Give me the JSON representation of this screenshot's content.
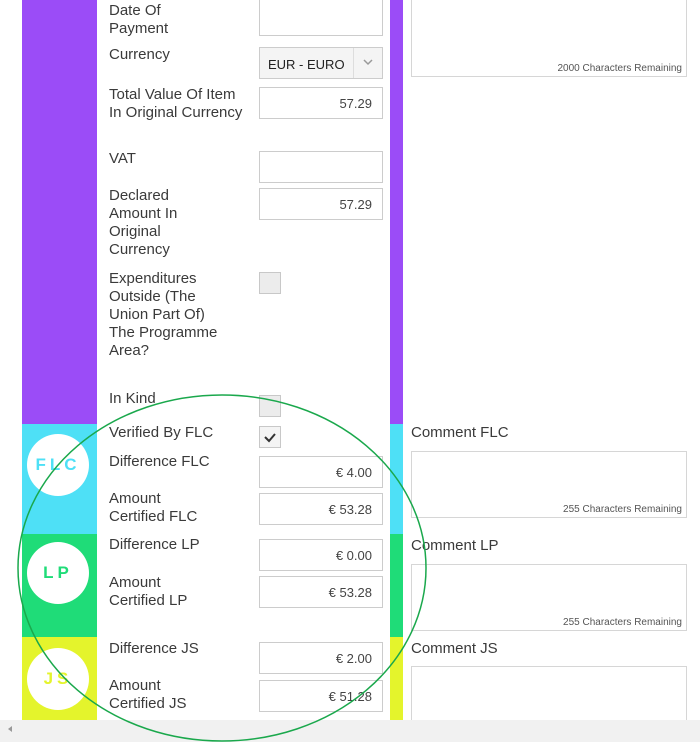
{
  "fields": {
    "date_of_payment": "Date Of Payment",
    "currency": "Currency",
    "currency_value": "EUR - EURO",
    "total_value": "Total Value Of Item In Original Currency",
    "total_value_amount": "57.29",
    "vat": "VAT",
    "vat_amount": "",
    "declared_amount": "Declared Amount In Original Currency",
    "declared_amount_value": "57.29",
    "expenditures_outside": "Expenditures Outside (The Union Part Of) The Programme Area?",
    "in_kind": "In Kind"
  },
  "top_textarea": {
    "remaining": "2000 Characters Remaining"
  },
  "flc": {
    "badge": "FLC",
    "verified_label": "Verified By FLC",
    "difference_label": "Difference FLC",
    "difference_value": "€ 4.00",
    "certified_label": "Amount Certified FLC",
    "certified_value": "€ 53.28",
    "comment_label": "Comment FLC",
    "remaining": "255 Characters Remaining",
    "color": "#4ee0f6"
  },
  "lp": {
    "badge": "LP",
    "difference_label": "Difference LP",
    "difference_value": "€ 0.00",
    "certified_label": "Amount Certified LP",
    "certified_value": "€ 53.28",
    "comment_label": "Comment LP",
    "remaining": "255 Characters Remaining",
    "color": "#1fdc78"
  },
  "js": {
    "badge": "JS",
    "difference_label": "Difference JS",
    "difference_value": "€ 2.00",
    "certified_label": "Amount Certified JS",
    "certified_value": "€ 51.28",
    "comment_label": "Comment JS",
    "color": "#e4f42c"
  },
  "colors": {
    "purple": "#9b4cf7",
    "annotation_circle": "#1aa84c"
  }
}
